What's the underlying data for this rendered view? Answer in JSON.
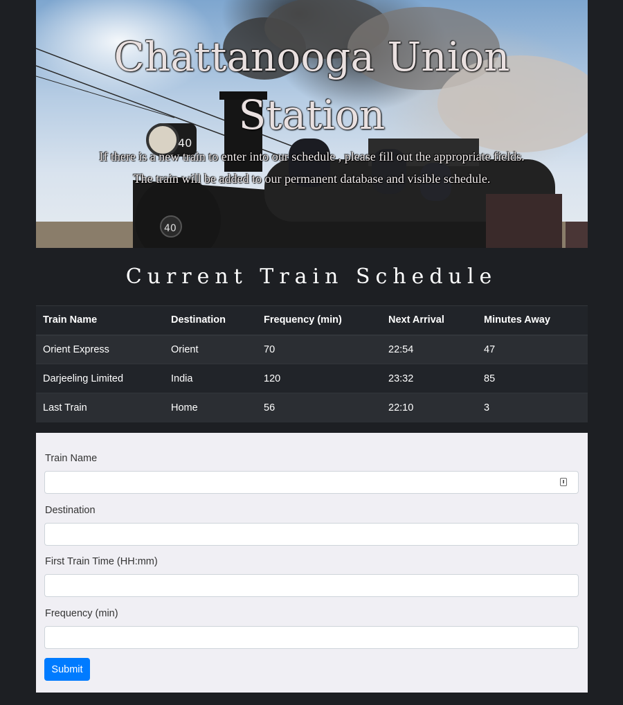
{
  "hero": {
    "title": "Chattanooga Union Station",
    "subtitle_line1": "If there is a new train to enter into our schedule , please fill out the appropriate fields.",
    "subtitle_line2": "The train will be added to our permanent database and visible schedule.",
    "locomotive_number": "40"
  },
  "schedule": {
    "heading": "Current Train Schedule",
    "columns": [
      "Train Name",
      "Destination",
      "Frequency (min)",
      "Next Arrival",
      "Minutes Away"
    ],
    "rows": [
      [
        "Orient Express",
        "Orient",
        "70",
        "22:54",
        "47"
      ],
      [
        "Darjeeling Limited",
        "India",
        "120",
        "23:32",
        "85"
      ],
      [
        "Last Train",
        "Home",
        "56",
        "22:10",
        "3"
      ]
    ]
  },
  "form": {
    "train_name_label": "Train Name",
    "train_name_value": "",
    "destination_label": "Destination",
    "destination_value": "",
    "first_time_label": "First Train Time (HH:mm)",
    "first_time_value": "",
    "frequency_label": "Frequency (min)",
    "frequency_value": "",
    "submit_label": "Submit"
  },
  "colors": {
    "page_bg": "#1d1f23",
    "accent": "#007bff",
    "form_bg": "#f0eff4"
  }
}
